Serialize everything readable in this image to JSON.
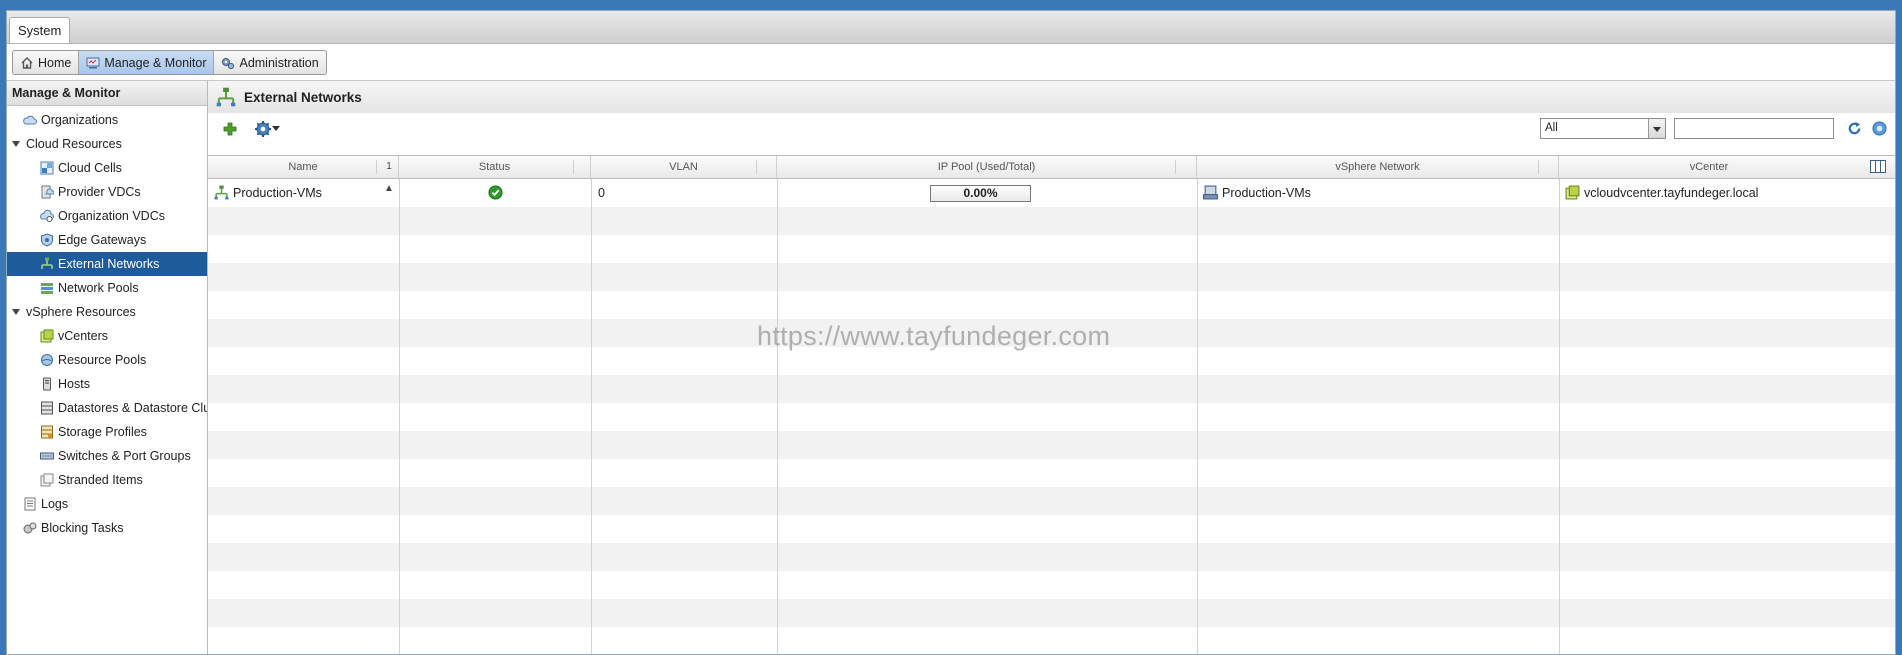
{
  "top_tab": {
    "label": "System"
  },
  "nav": {
    "home": "Home",
    "manage_monitor": "Manage & Monitor",
    "administration": "Administration"
  },
  "sidebar": {
    "title": "Manage & Monitor",
    "items": [
      {
        "label": "Organizations",
        "icon": "cloud-icon"
      },
      {
        "label": "Cloud Resources",
        "icon": "collapse-caret"
      },
      {
        "label": "Cloud Cells",
        "icon": "cloud-cells-icon"
      },
      {
        "label": "Provider VDCs",
        "icon": "provider-vdc-icon"
      },
      {
        "label": "Organization VDCs",
        "icon": "org-vdc-icon"
      },
      {
        "label": "Edge Gateways",
        "icon": "edge-gateway-icon"
      },
      {
        "label": "External Networks",
        "icon": "external-network-icon",
        "selected": true
      },
      {
        "label": "Network Pools",
        "icon": "network-pool-icon"
      },
      {
        "label": "vSphere Resources",
        "icon": "collapse-caret"
      },
      {
        "label": "vCenters",
        "icon": "vcenter-icon"
      },
      {
        "label": "Resource Pools",
        "icon": "resource-pool-icon"
      },
      {
        "label": "Hosts",
        "icon": "host-icon"
      },
      {
        "label": "Datastores & Datastore Clu",
        "icon": "datastore-icon"
      },
      {
        "label": "Storage Profiles",
        "icon": "storage-profile-icon"
      },
      {
        "label": "Switches & Port Groups",
        "icon": "switch-icon"
      },
      {
        "label": "Stranded Items",
        "icon": "stranded-items-icon"
      },
      {
        "label": "Logs",
        "icon": "logs-icon"
      },
      {
        "label": "Blocking Tasks",
        "icon": "blocking-tasks-icon"
      }
    ]
  },
  "main": {
    "title": "External Networks",
    "filter": {
      "selected": "All"
    },
    "search": {
      "value": ""
    },
    "columns": {
      "name": "Name",
      "sort": "1 ▲",
      "status": "Status",
      "vlan": "VLAN",
      "ip_pool": "IP Pool (Used/Total)",
      "vsphere_network": "vSphere Network",
      "vcenter": "vCenter"
    },
    "rows": [
      {
        "name": "Production-VMs",
        "status": "ok",
        "vlan": "0",
        "ip_pool": "0.00%",
        "ip_pool_used_fraction": 0,
        "vsphere_network": "Production-VMs",
        "vcenter": "vcloudvcenter.tayfundeger.local"
      }
    ]
  },
  "watermark": "https://www.tayfundeger.com",
  "colors": {
    "selected_bg": "#1e5b9b",
    "status_ok": "#2e9a2e",
    "accent": "#3b79b6"
  }
}
